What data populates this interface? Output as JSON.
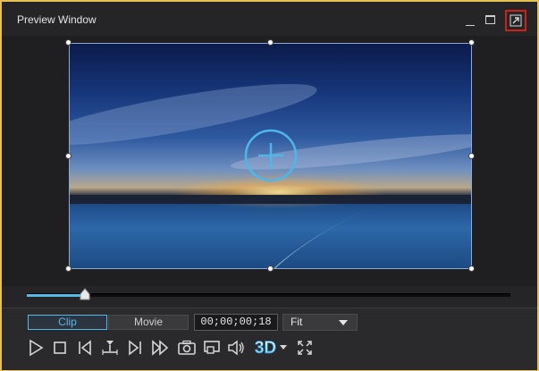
{
  "window": {
    "title": "Preview Window"
  },
  "seek": {
    "progress": 0.12
  },
  "mode": {
    "clip_label": "Clip",
    "movie_label": "Movie",
    "active": "Clip"
  },
  "timecode": {
    "value": "00;00;00;18"
  },
  "zoom": {
    "selected": "Fit"
  },
  "toolbar": {
    "three_d_label": "3D"
  },
  "colors": {
    "accent": "#56b9e8",
    "frame": "#e6bf55",
    "highlight": "#d0201c"
  },
  "icons": [
    "minimize-icon",
    "maximize-icon",
    "detach-icon",
    "add-icon",
    "play-icon",
    "stop-icon",
    "previous-frame-icon",
    "split-icon",
    "next-frame-icon",
    "fast-forward-icon",
    "snapshot-icon",
    "display-icon",
    "volume-icon",
    "3d-icon",
    "dropdown-arrow-icon",
    "fullscreen-icon"
  ]
}
